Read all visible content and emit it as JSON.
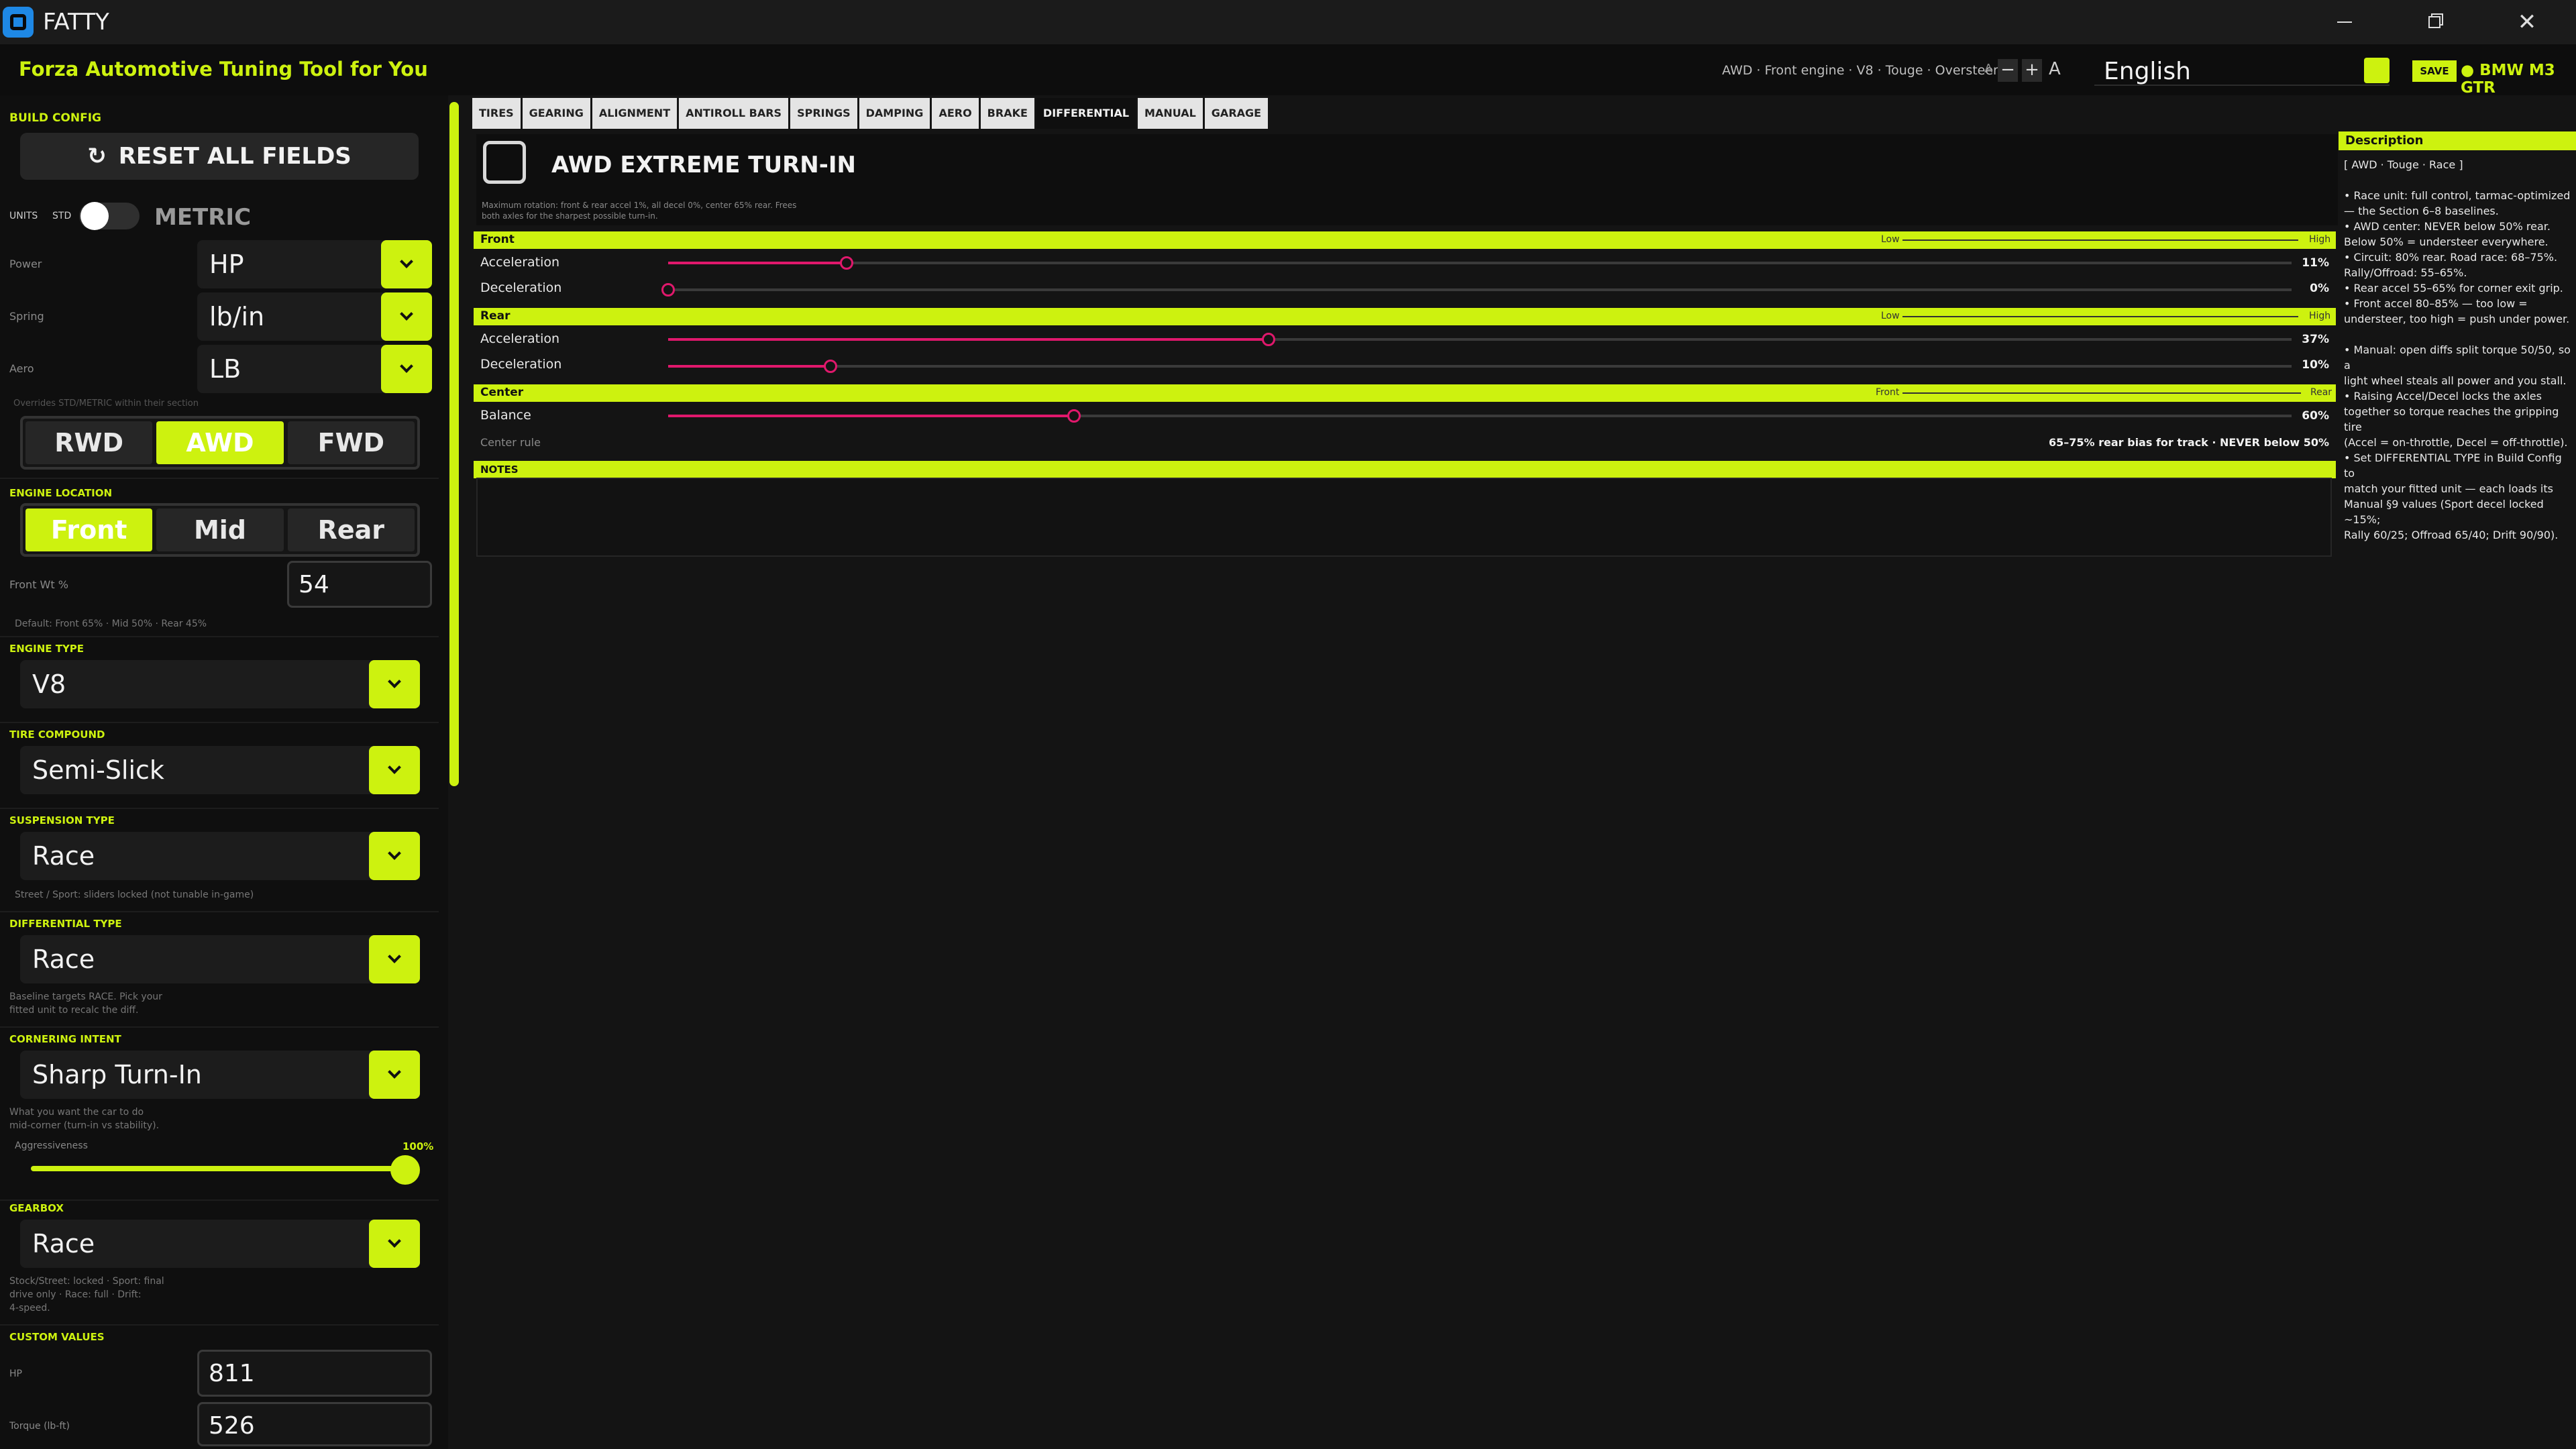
{
  "app": {
    "title": "FATTY"
  },
  "header": {
    "brand": "Forza Automotive Tuning Tool for You",
    "build_info": "AWD · Front engine · V8 · Touge · Oversteer",
    "font_a_small": "A",
    "font_minus": "−",
    "font_plus": "+",
    "font_a_large": "A",
    "language": "English",
    "save": "SAVE",
    "car": "● BMW M3 GTR"
  },
  "sidebar": {
    "build_config": "BUILD CONFIG",
    "reset": "RESET ALL FIELDS",
    "units_label": "UNITS",
    "units_std": "STD",
    "units_metric": "METRIC",
    "power_label": "Power",
    "power_value": "HP",
    "spring_label": "Spring",
    "spring_value": "lb/in",
    "aero_label": "Aero",
    "aero_value": "LB",
    "overrides_hint": "Overrides STD/METRIC within their section",
    "drivetrain": [
      "RWD",
      "AWD",
      "FWD"
    ],
    "drivetrain_selected": "AWD",
    "engine_location_label": "ENGINE LOCATION",
    "engine_location": [
      "Front",
      "Mid",
      "Rear"
    ],
    "front_wt_label": "Front Wt %",
    "front_wt_value": "54",
    "front_wt_hint": "Default: Front 65% · Mid 50% · Rear 45%",
    "engine_type_label": "ENGINE TYPE",
    "engine_type": "V8",
    "tire_compound_label": "TIRE COMPOUND",
    "tire_compound": "Semi-Slick",
    "suspension_type_label": "SUSPENSION TYPE",
    "suspension_type": "Race",
    "suspension_hint": "Street / Sport: sliders locked (not tunable in-game)",
    "differential_type_label": "DIFFERENTIAL TYPE",
    "differential_type": "Race",
    "differential_hint_1": "Baseline targets RACE. Pick your",
    "differential_hint_2": "fitted unit to recalc the diff.",
    "cornering_intent_label": "CORNERING INTENT",
    "cornering_intent": "Sharp Turn-In",
    "cornering_hint_1": "What you want the car to do",
    "cornering_hint_2": "mid-corner (turn-in vs stability).",
    "aggressiveness_label": "Aggressiveness",
    "aggressiveness_value": "100%",
    "aggressiveness_fraction": 1.0,
    "gearbox_label": "GEARBOX",
    "gearbox": "Race",
    "gearbox_hint_1": "Stock/Street: locked · Sport: final",
    "gearbox_hint_2": "drive only · Race: full · Drift:",
    "gearbox_hint_3": "4-speed.",
    "custom_values_label": "CUSTOM VALUES",
    "hp_label": "HP",
    "hp_value": "811",
    "torque_label": "Torque (lb-ft)",
    "torque_value": "526"
  },
  "tabs": [
    "TIRES",
    "GEARING",
    "ALIGNMENT",
    "ANTIROLL BARS",
    "SPRINGS",
    "DAMPING",
    "AERO",
    "BRAKE",
    "DIFFERENTIAL",
    "MANUAL",
    "GARAGE"
  ],
  "active_tab": "DIFFERENTIAL",
  "preset": {
    "title": "AWD EXTREME TURN-IN",
    "desc_1": "Maximum rotation: front & rear accel 1%, all decel 0%, center 65% rear. Frees",
    "desc_2": "both axles for the sharpest possible turn-in."
  },
  "differential": {
    "front": {
      "title": "Front",
      "low": "Low",
      "high": "High",
      "accel_label": "Acceleration",
      "accel_value": "11%",
      "accel_fraction": 0.11,
      "decel_label": "Deceleration",
      "decel_value": "0%",
      "decel_fraction": 0.0
    },
    "rear": {
      "title": "Rear",
      "low": "Low",
      "high": "High",
      "accel_label": "Acceleration",
      "accel_value": "37%",
      "accel_fraction": 0.37,
      "decel_label": "Deceleration",
      "decel_value": "10%",
      "decel_fraction": 0.1
    },
    "center": {
      "title": "Center",
      "low": "Front",
      "high": "Rear",
      "balance_label": "Balance",
      "balance_value": "60%",
      "balance_fraction": 0.25,
      "rule_label": "Center rule",
      "rule_value": "65–75% rear bias for track  ·  NEVER below 50%"
    },
    "notes_label": "NOTES"
  },
  "description": {
    "title": "Description",
    "tags": "[ AWD  ·  Touge  ·  Race ]",
    "lines_a": [
      "• Race unit: full control, tarmac-optimized",
      "— the Section 6–8 baselines.",
      "• AWD center: NEVER below 50% rear.",
      "Below 50% = understeer everywhere.",
      "• Circuit: 80% rear. Road race: 68–75%.",
      "Rally/Offroad: 55–65%.",
      "• Rear accel 55–65% for corner exit grip.",
      "• Front accel 80–85% — too low =",
      "understeer, too high = push under power."
    ],
    "lines_b": [
      "• Manual: open diffs split torque 50/50, so a",
      "light wheel steals all power and you stall.",
      "• Raising Accel/Decel locks the axles",
      "together so torque reaches the gripping tire",
      "(Accel = on-throttle, Decel = off-throttle).",
      "• Set DIFFERENTIAL TYPE in Build Config to",
      "match your fitted unit — each loads its",
      "Manual §9 values (Sport decel locked ~15%;",
      "Rally 60/25; Offroad 65/40; Drift 90/90)."
    ]
  },
  "colors": {
    "accent": "#cdf20f",
    "slider": "#e0186c",
    "background": "#141414"
  }
}
